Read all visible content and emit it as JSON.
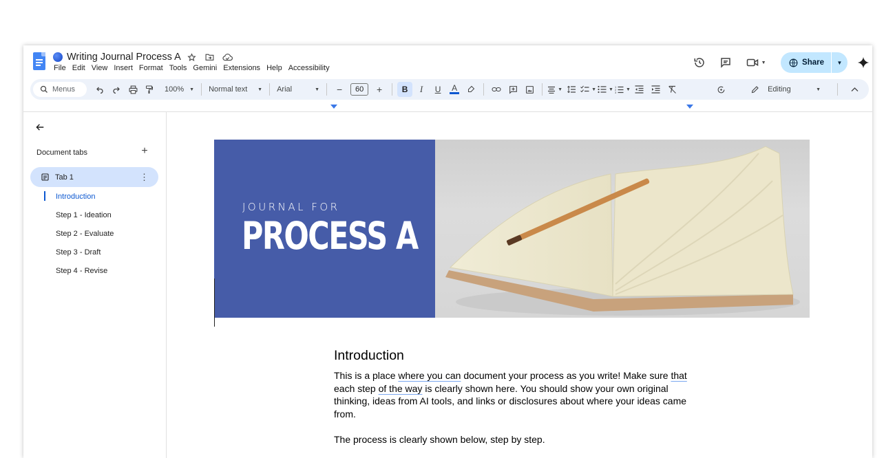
{
  "window": {
    "doc_title": "Writing Journal Process A",
    "menu": [
      "File",
      "Edit",
      "View",
      "Insert",
      "Format",
      "Tools",
      "Gemini",
      "Extensions",
      "Help",
      "Accessibility"
    ],
    "share_label": "Share"
  },
  "toolbar": {
    "search_placeholder": "Menus",
    "zoom": "100%",
    "style": "Normal text",
    "font": "Arial",
    "font_size": "60",
    "mode": "Editing"
  },
  "sidebar": {
    "heading": "Document tabs",
    "tab_label": "Tab 1",
    "outline": [
      "Introduction",
      "Step 1 - Ideation",
      "Step 2 - Evaluate",
      "Step 3 - Draft",
      "Step 4 - Revise"
    ]
  },
  "document": {
    "banner_subtitle": "JOURNAL FOR",
    "banner_title": "PROCESS A",
    "heading": "Introduction",
    "p1": {
      "a": "This is a place ",
      "b": "where you can",
      "c": " document your process as you write! Make sure ",
      "d": "that",
      "e": " each step ",
      "f": "of the way",
      "g": " is clearly shown here. You should show your own original thinking, ideas from AI tools, and links or disclosures about where your ideas came from."
    },
    "p2": "The process is clearly shown below, step by step."
  },
  "colors": {
    "accent": "#0b57d0",
    "share_bg": "#c2e7ff",
    "toolbar_bg": "#edf2fa",
    "banner_blue": "#465ca8"
  }
}
